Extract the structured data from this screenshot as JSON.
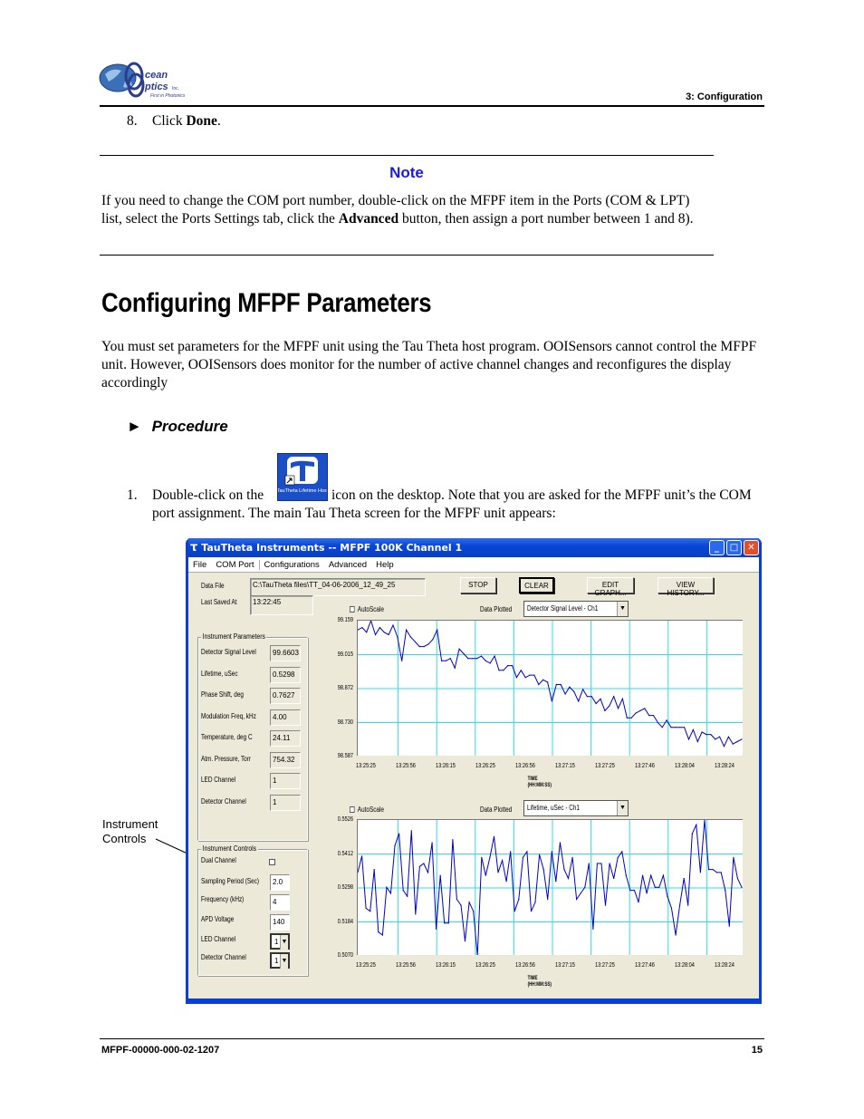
{
  "header": {
    "logo": {
      "line1": "cean",
      "line2": "ptics",
      "inc": "Inc.",
      "tagline": "First in Photonics"
    },
    "section": "3: Configuration"
  },
  "step8": {
    "number": "8.",
    "prefix": "Click ",
    "bold": "Done",
    "suffix": "."
  },
  "note": {
    "title": "Note",
    "text_before": "If you need to change the COM port number, double-click on the MFPF item in the Ports (COM & LPT) list, select the Ports Settings tab, click the ",
    "bold": "Advanced",
    "text_after": " button, then assign a port number between 1 and 8)."
  },
  "heading": "Configuring MFPF Parameters",
  "intro": "You must set parameters for the MFPF unit using the Tau Theta host program. OOISensors cannot control the MFPF unit. However, OOISensors does monitor for the number of active channel changes and reconfigures the display accordingly",
  "procedure": {
    "marker": "►",
    "label": "Procedure"
  },
  "step1": {
    "number": "1.",
    "before_icon": "Double-click on the ",
    "after_icon": " icon on the desktop. Note that you are asked for the MFPF unit’s the COM port assignment. The main Tau Theta screen for the MFPF unit appears:",
    "icon_caption": "TauTheta Lifetime Host"
  },
  "annotation": {
    "line1": "Instrument",
    "line2": "Controls"
  },
  "app": {
    "title": "TauTheta Instruments -- MFPF 100K Channel 1",
    "menu": [
      "File",
      "COM Port",
      "Configurations",
      "Advanced",
      "Help"
    ],
    "data_file_label": "Data File",
    "data_file_value": "C:\\TauTheta files\\TT_04-06-2006_12_49_25",
    "last_saved_label": "Last Saved At",
    "last_saved_value": "13:22:45",
    "buttons": {
      "stop": "STOP",
      "clear": "CLEAR",
      "edit_graph": "EDIT GRAPH...",
      "view_history": "VIEW HISTORY..."
    },
    "instrument_parameters": {
      "title": "Instrument Parameters",
      "rows": [
        {
          "label": "Detector Signal Level",
          "value": "99.6603"
        },
        {
          "label": "Lifetime, uSec",
          "value": "0.5298"
        },
        {
          "label": "Phase Shift, deg",
          "value": "0.7627"
        },
        {
          "label": "Modulation Freq, kHz",
          "value": "4.00"
        },
        {
          "label": "Temperature, deg C",
          "value": "24.11"
        },
        {
          "label": "Atm. Pressure, Torr",
          "value": "754.32"
        },
        {
          "label": "LED Channel",
          "value": "1"
        },
        {
          "label": "Detector Channel",
          "value": "1"
        }
      ]
    },
    "instrument_controls": {
      "title": "Instrument Controls",
      "dual_channel_label": "Dual Channel",
      "dual_channel_checked": false,
      "sampling_period_label": "Sampling Period (Sec)",
      "sampling_period_value": "2.0",
      "frequency_label": "Frequency (kHz)",
      "frequency_value": "4",
      "apd_voltage_label": "APD Voltage",
      "apd_voltage_value": "140",
      "led_channel_label": "LED Channel",
      "led_channel_value": "1",
      "detector_channel_label": "Detector Channel",
      "detector_channel_value": "1"
    },
    "graph1": {
      "autoscale_label": "AutoScale",
      "data_plotted_label": "Data Plotted",
      "data_plotted_value": "Detector Signal Level - Ch1"
    },
    "graph2": {
      "autoscale_label": "AutoScale",
      "data_plotted_label": "Data Plotted",
      "data_plotted_value": "Lifetime, uSec - Ch1"
    }
  },
  "chart_data": [
    {
      "type": "line",
      "title": "Detector Signal Level - Ch1",
      "xlabel": "TIME (HH:MM:SS)",
      "ylabel": "",
      "yticks": [
        "99.159",
        "99.015",
        "98.872",
        "98.730",
        "98.587"
      ],
      "ylim": [
        98.587,
        99.159
      ],
      "xticks": [
        "13:25:25",
        "13:25:56",
        "13:26:15",
        "13:26:25",
        "13:26:56",
        "13:27:15",
        "13:27:25",
        "13:27:46",
        "13:28:04",
        "13:28:24"
      ],
      "grid": true,
      "color": "#0000cc",
      "values": [
        99.12,
        99.13,
        99.11,
        99.16,
        99.1,
        99.13,
        99.11,
        99.1,
        99.14,
        99.09,
        98.99,
        99.12,
        99.09,
        99.07,
        99.05,
        99.05,
        99.06,
        99.08,
        99.12,
        98.99,
        98.99,
        99.0,
        98.96,
        99.04,
        99.02,
        99.0,
        99.0,
        99.0,
        99.01,
        98.99,
        98.98,
        99.01,
        98.95,
        98.95,
        98.97,
        98.97,
        98.92,
        98.95,
        98.92,
        98.93,
        98.93,
        98.89,
        98.91,
        98.9,
        98.82,
        98.89,
        98.89,
        98.85,
        98.88,
        98.86,
        98.82,
        98.87,
        98.84,
        98.84,
        98.81,
        98.83,
        98.78,
        98.8,
        98.84,
        98.79,
        98.83,
        98.75,
        98.75,
        98.77,
        98.78,
        98.79,
        98.76,
        98.76,
        98.73,
        98.71,
        98.74,
        98.71,
        98.71,
        98.71,
        98.71,
        98.66,
        98.7,
        98.65,
        98.69,
        98.68,
        98.68,
        98.66,
        98.67,
        98.63,
        98.67,
        98.64,
        98.65,
        98.66
      ]
    },
    {
      "type": "line",
      "title": "Lifetime, uSec - Ch1",
      "xlabel": "TIME (HH:MM:SS)",
      "ylabel": "",
      "yticks": [
        "0.5526",
        "0.5412",
        "0.5298",
        "0.5184",
        "0.5070"
      ],
      "ylim": [
        0.507,
        0.5526
      ],
      "xticks": [
        "13:25:25",
        "13:25:56",
        "13:26:15",
        "13:26:25",
        "13:26:56",
        "13:27:15",
        "13:27:25",
        "13:27:46",
        "13:28:04",
        "13:28:24"
      ],
      "grid": true,
      "color": "#0000cc",
      "values": [
        0.535,
        0.5405,
        0.523,
        0.522,
        0.536,
        0.515,
        0.514,
        0.53,
        0.528,
        0.544,
        0.548,
        0.529,
        0.527,
        0.549,
        0.521,
        0.537,
        0.538,
        0.535,
        0.545,
        0.516,
        0.534,
        0.518,
        0.518,
        0.546,
        0.526,
        0.524,
        0.512,
        0.525,
        0.522,
        0.507,
        0.54,
        0.534,
        0.54,
        0.547,
        0.535,
        0.539,
        0.532,
        0.542,
        0.522,
        0.526,
        0.54,
        0.542,
        0.522,
        0.525,
        0.541,
        0.536,
        0.526,
        0.542,
        0.532,
        0.545,
        0.536,
        0.533,
        0.54,
        0.526,
        0.528,
        0.53,
        0.538,
        0.516,
        0.538,
        0.538,
        0.524,
        0.538,
        0.533,
        0.54,
        0.542,
        0.534,
        0.529,
        0.529,
        0.525,
        0.534,
        0.528,
        0.534,
        0.53,
        0.53,
        0.534,
        0.527,
        0.523,
        0.514,
        0.524,
        0.533,
        0.524,
        0.548,
        0.551,
        0.535,
        0.5526,
        0.536,
        0.536,
        0.535,
        0.535,
        0.529,
        0.517,
        0.54,
        0.533,
        0.53
      ]
    }
  ],
  "footer": {
    "doc_id": "MFPF-00000-000-02-1207",
    "page": "15"
  }
}
